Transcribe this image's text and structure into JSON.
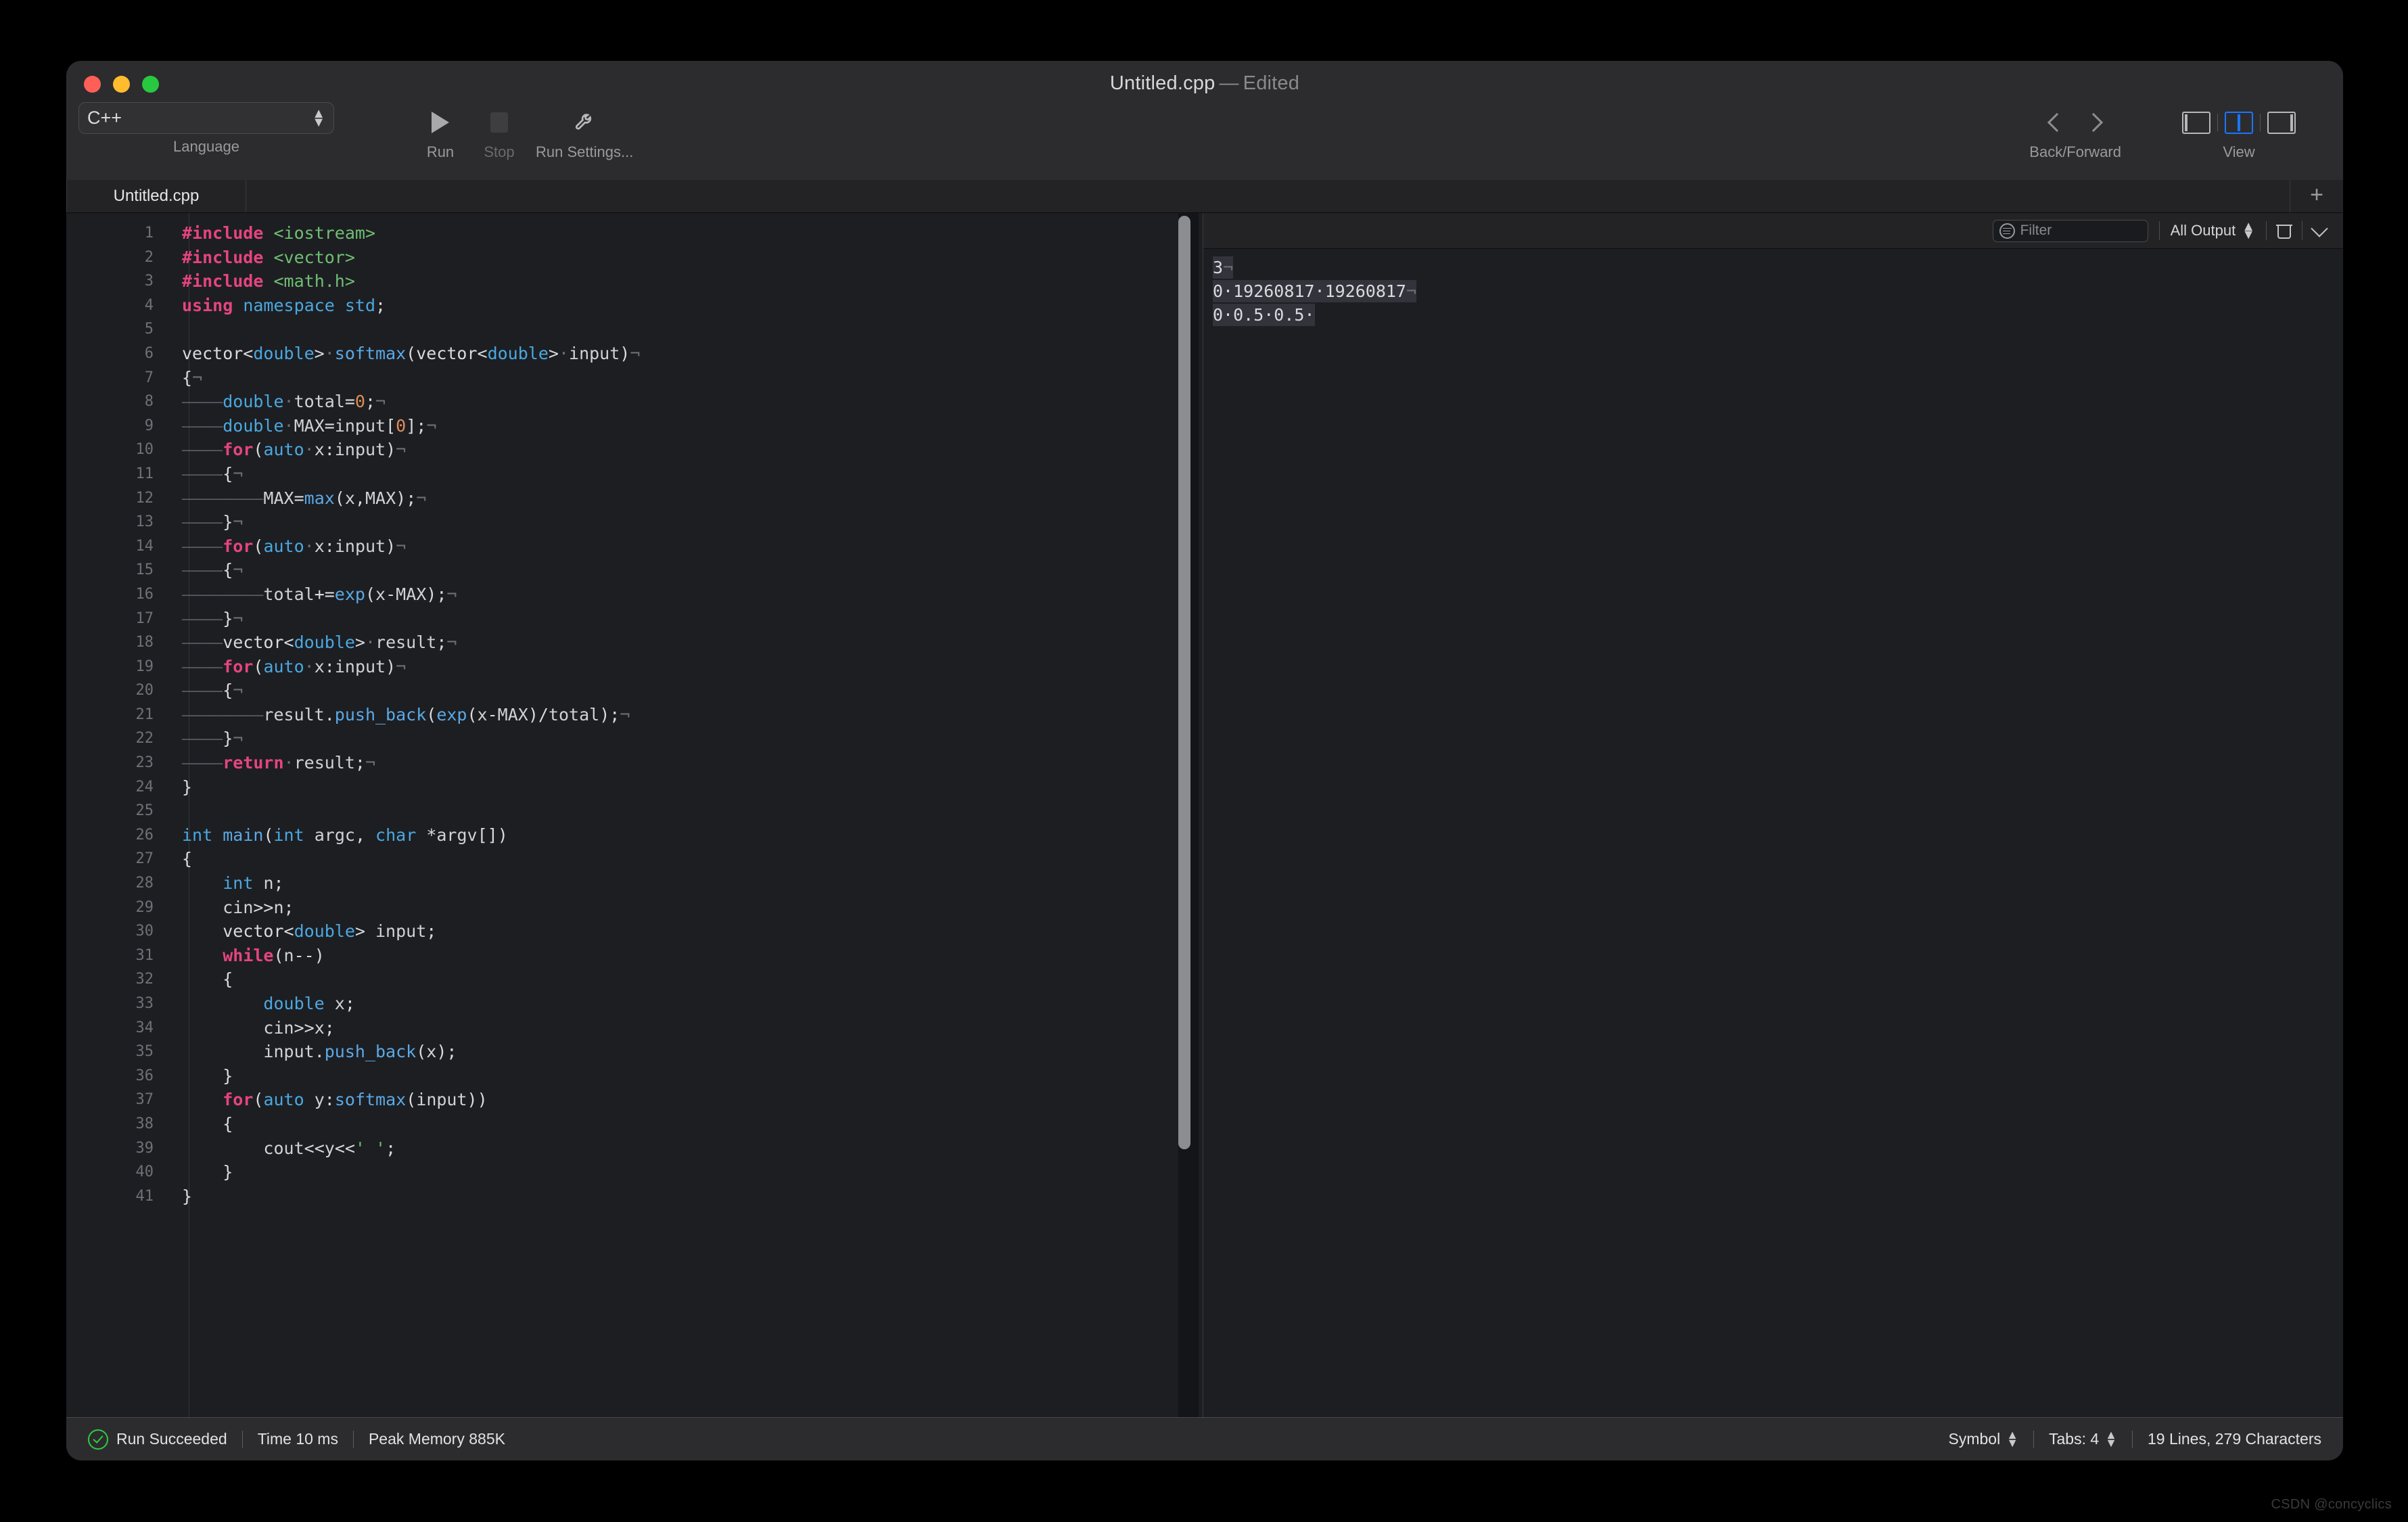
{
  "window": {
    "title_file": "Untitled.cpp",
    "title_dash": "—",
    "title_state": "Edited"
  },
  "toolbar": {
    "language": {
      "value": "C++",
      "label": "Language"
    },
    "run": {
      "label": "Run",
      "icon": "play-icon"
    },
    "stop": {
      "label": "Stop",
      "icon": "stop-icon"
    },
    "run_settings": {
      "label": "Run Settings...",
      "icon": "wrench-icon"
    },
    "back_forward": {
      "label": "Back/Forward",
      "back_icon": "chevron-left-icon",
      "forward_icon": "chevron-right-icon"
    },
    "view": {
      "label": "View",
      "options": [
        "left-panel",
        "center-panel",
        "right-panel"
      ],
      "active": "center-panel",
      "accent": "#1b75ff"
    }
  },
  "tabs": {
    "items": [
      {
        "label": "Untitled.cpp",
        "active": true
      }
    ],
    "new_tab_label": "+"
  },
  "console": {
    "filter_placeholder": "Filter",
    "filter_value": "",
    "scope": "All Output",
    "clear_icon": "trash-icon",
    "expand_icon": "chevron-down-icon",
    "output": [
      {
        "text": "3",
        "trailing": "¬",
        "highlighted": true
      },
      {
        "text": "0·19260817·19260817",
        "trailing": "¬",
        "highlighted": true
      },
      {
        "text": "0·0.5·0.5·",
        "trailing": "",
        "highlighted": true
      }
    ]
  },
  "statusbar": {
    "run_status": "Run Succeeded",
    "status_icon": "check-circle-icon",
    "time": "Time 10 ms",
    "memory": "Peak Memory 885K",
    "symbol": "Symbol",
    "tabs_setting": "Tabs: 4",
    "counts": "19 Lines, 279 Characters"
  },
  "watermark": "CSDN @concyclics",
  "editor": {
    "total_lines": 41,
    "selection_start_line": 6,
    "selection_end_line": 24,
    "code_lines": [
      {
        "n": 1,
        "sel": false,
        "tokens": [
          [
            "kw",
            "#include"
          ],
          [
            "pun",
            " "
          ],
          [
            "str",
            "<iostream>"
          ]
        ]
      },
      {
        "n": 2,
        "sel": false,
        "tokens": [
          [
            "kw",
            "#include"
          ],
          [
            "pun",
            " "
          ],
          [
            "str",
            "<vector>"
          ]
        ]
      },
      {
        "n": 3,
        "sel": false,
        "tokens": [
          [
            "kw",
            "#include"
          ],
          [
            "pun",
            " "
          ],
          [
            "str",
            "<math.h>"
          ]
        ]
      },
      {
        "n": 4,
        "sel": false,
        "tokens": [
          [
            "kw",
            "using"
          ],
          [
            "pun",
            " "
          ],
          [
            "ty",
            "namespace"
          ],
          [
            "pun",
            " "
          ],
          [
            "ty",
            "std"
          ],
          [
            "pun",
            ";"
          ]
        ]
      },
      {
        "n": 5,
        "sel": false,
        "tokens": []
      },
      {
        "n": 6,
        "sel": true,
        "tokens": [
          [
            "pun",
            "vector<"
          ],
          [
            "ty",
            "double"
          ],
          [
            "pun",
            ">"
          ],
          [
            "inv",
            "·"
          ],
          [
            "fn",
            "softmax"
          ],
          [
            "pun",
            "("
          ],
          [
            "pun",
            "vector<"
          ],
          [
            "ty",
            "double"
          ],
          [
            "pun",
            ">"
          ],
          [
            "inv",
            "·"
          ],
          [
            "id",
            "input"
          ],
          [
            "pun",
            ")"
          ],
          [
            "inv",
            "¬"
          ]
        ]
      },
      {
        "n": 7,
        "sel": true,
        "tokens": [
          [
            "pun",
            "{"
          ],
          [
            "inv",
            "¬"
          ]
        ]
      },
      {
        "n": 8,
        "sel": true,
        "tokens": [
          [
            "tab-mark",
            "————"
          ],
          [
            "ty",
            "double"
          ],
          [
            "inv",
            "·"
          ],
          [
            "id",
            "total"
          ],
          [
            "pun",
            "="
          ],
          [
            "num",
            "0"
          ],
          [
            "pun",
            ";"
          ],
          [
            "inv",
            "¬"
          ]
        ]
      },
      {
        "n": 9,
        "sel": true,
        "tokens": [
          [
            "tab-mark",
            "————"
          ],
          [
            "ty",
            "double"
          ],
          [
            "inv",
            "·"
          ],
          [
            "id",
            "MAX"
          ],
          [
            "pun",
            "="
          ],
          [
            "id",
            "input"
          ],
          [
            "pun",
            "["
          ],
          [
            "num",
            "0"
          ],
          [
            "pun",
            "];"
          ],
          [
            "inv",
            "¬"
          ]
        ]
      },
      {
        "n": 10,
        "sel": true,
        "tokens": [
          [
            "tab-mark",
            "————"
          ],
          [
            "kw",
            "for"
          ],
          [
            "pun",
            "("
          ],
          [
            "ty",
            "auto"
          ],
          [
            "inv",
            "·"
          ],
          [
            "id",
            "x"
          ],
          [
            "pun",
            ":"
          ],
          [
            "id",
            "input"
          ],
          [
            "pun",
            ")"
          ],
          [
            "inv",
            "¬"
          ]
        ]
      },
      {
        "n": 11,
        "sel": true,
        "tokens": [
          [
            "tab-mark",
            "————"
          ],
          [
            "pun",
            "{"
          ],
          [
            "inv",
            "¬"
          ]
        ]
      },
      {
        "n": 12,
        "sel": true,
        "tokens": [
          [
            "tab-mark",
            "————————"
          ],
          [
            "id",
            "MAX"
          ],
          [
            "pun",
            "="
          ],
          [
            "fn",
            "max"
          ],
          [
            "pun",
            "("
          ],
          [
            "id",
            "x"
          ],
          [
            "pun",
            ","
          ],
          [
            "id",
            "MAX"
          ],
          [
            "pun",
            ");"
          ],
          [
            "inv",
            "¬"
          ]
        ]
      },
      {
        "n": 13,
        "sel": true,
        "tokens": [
          [
            "tab-mark",
            "————"
          ],
          [
            "pun",
            "}"
          ],
          [
            "inv",
            "¬"
          ]
        ]
      },
      {
        "n": 14,
        "sel": true,
        "tokens": [
          [
            "tab-mark",
            "————"
          ],
          [
            "kw",
            "for"
          ],
          [
            "pun",
            "("
          ],
          [
            "ty",
            "auto"
          ],
          [
            "inv",
            "·"
          ],
          [
            "id",
            "x"
          ],
          [
            "pun",
            ":"
          ],
          [
            "id",
            "input"
          ],
          [
            "pun",
            ")"
          ],
          [
            "inv",
            "¬"
          ]
        ]
      },
      {
        "n": 15,
        "sel": true,
        "tokens": [
          [
            "tab-mark",
            "————"
          ],
          [
            "pun",
            "{"
          ],
          [
            "inv",
            "¬"
          ]
        ]
      },
      {
        "n": 16,
        "sel": true,
        "tokens": [
          [
            "tab-mark",
            "————————"
          ],
          [
            "id",
            "total"
          ],
          [
            "pun",
            "+="
          ],
          [
            "fn",
            "exp"
          ],
          [
            "pun",
            "("
          ],
          [
            "id",
            "x"
          ],
          [
            "pun",
            "-"
          ],
          [
            "id",
            "MAX"
          ],
          [
            "pun",
            ");"
          ],
          [
            "inv",
            "¬"
          ]
        ]
      },
      {
        "n": 17,
        "sel": true,
        "tokens": [
          [
            "tab-mark",
            "————"
          ],
          [
            "pun",
            "}"
          ],
          [
            "inv",
            "¬"
          ]
        ]
      },
      {
        "n": 18,
        "sel": true,
        "tokens": [
          [
            "tab-mark",
            "————"
          ],
          [
            "pun",
            "vector<"
          ],
          [
            "ty",
            "double"
          ],
          [
            "pun",
            ">"
          ],
          [
            "inv",
            "·"
          ],
          [
            "id",
            "result"
          ],
          [
            "pun",
            ";"
          ],
          [
            "inv",
            "¬"
          ]
        ]
      },
      {
        "n": 19,
        "sel": true,
        "tokens": [
          [
            "tab-mark",
            "————"
          ],
          [
            "kw",
            "for"
          ],
          [
            "pun",
            "("
          ],
          [
            "ty",
            "auto"
          ],
          [
            "inv",
            "·"
          ],
          [
            "id",
            "x"
          ],
          [
            "pun",
            ":"
          ],
          [
            "id",
            "input"
          ],
          [
            "pun",
            ")"
          ],
          [
            "inv",
            "¬"
          ]
        ]
      },
      {
        "n": 20,
        "sel": true,
        "tokens": [
          [
            "tab-mark",
            "————"
          ],
          [
            "pun",
            "{"
          ],
          [
            "inv",
            "¬"
          ]
        ]
      },
      {
        "n": 21,
        "sel": true,
        "tokens": [
          [
            "tab-mark",
            "————————"
          ],
          [
            "id",
            "result"
          ],
          [
            "pun",
            "."
          ],
          [
            "fn",
            "push_back"
          ],
          [
            "pun",
            "("
          ],
          [
            "fn",
            "exp"
          ],
          [
            "pun",
            "("
          ],
          [
            "id",
            "x"
          ],
          [
            "pun",
            "-"
          ],
          [
            "id",
            "MAX"
          ],
          [
            "pun",
            ")/"
          ],
          [
            "id",
            "total"
          ],
          [
            "pun",
            ");"
          ],
          [
            "inv",
            "¬"
          ]
        ]
      },
      {
        "n": 22,
        "sel": true,
        "tokens": [
          [
            "tab-mark",
            "————"
          ],
          [
            "pun",
            "}"
          ],
          [
            "inv",
            "¬"
          ]
        ]
      },
      {
        "n": 23,
        "sel": true,
        "tokens": [
          [
            "tab-mark",
            "————"
          ],
          [
            "kw",
            "return"
          ],
          [
            "inv",
            "·"
          ],
          [
            "id",
            "result"
          ],
          [
            "pun",
            ";"
          ],
          [
            "inv",
            "¬"
          ]
        ]
      },
      {
        "n": 24,
        "sel": true,
        "tokens": [
          [
            "pun",
            "}"
          ]
        ]
      },
      {
        "n": 25,
        "sel": false,
        "tokens": []
      },
      {
        "n": 26,
        "sel": false,
        "tokens": [
          [
            "ty",
            "int"
          ],
          [
            "pun",
            " "
          ],
          [
            "fn",
            "main"
          ],
          [
            "pun",
            "("
          ],
          [
            "ty",
            "int"
          ],
          [
            "pun",
            " "
          ],
          [
            "id",
            "argc"
          ],
          [
            "pun",
            ", "
          ],
          [
            "ty",
            "char"
          ],
          [
            "pun",
            " *"
          ],
          [
            "id",
            "argv"
          ],
          [
            "pun",
            "[])"
          ]
        ]
      },
      {
        "n": 27,
        "sel": false,
        "tokens": [
          [
            "pun",
            "{"
          ]
        ]
      },
      {
        "n": 28,
        "sel": false,
        "tokens": [
          [
            "pun",
            "    "
          ],
          [
            "ty",
            "int"
          ],
          [
            "pun",
            " "
          ],
          [
            "id",
            "n"
          ],
          [
            "pun",
            ";"
          ]
        ]
      },
      {
        "n": 29,
        "sel": false,
        "tokens": [
          [
            "pun",
            "    "
          ],
          [
            "id",
            "cin"
          ],
          [
            "pun",
            ">>"
          ],
          [
            "id",
            "n"
          ],
          [
            "pun",
            ";"
          ]
        ]
      },
      {
        "n": 30,
        "sel": false,
        "tokens": [
          [
            "pun",
            "    "
          ],
          [
            "pun",
            "vector<"
          ],
          [
            "ty",
            "double"
          ],
          [
            "pun",
            "> "
          ],
          [
            "id",
            "input"
          ],
          [
            "pun",
            ";"
          ]
        ]
      },
      {
        "n": 31,
        "sel": false,
        "tokens": [
          [
            "pun",
            "    "
          ],
          [
            "kw",
            "while"
          ],
          [
            "pun",
            "("
          ],
          [
            "id",
            "n"
          ],
          [
            "pun",
            "--)"
          ]
        ]
      },
      {
        "n": 32,
        "sel": false,
        "tokens": [
          [
            "pun",
            "    {"
          ]
        ]
      },
      {
        "n": 33,
        "sel": false,
        "tokens": [
          [
            "pun",
            "        "
          ],
          [
            "ty",
            "double"
          ],
          [
            "pun",
            " "
          ],
          [
            "id",
            "x"
          ],
          [
            "pun",
            ";"
          ]
        ]
      },
      {
        "n": 34,
        "sel": false,
        "tokens": [
          [
            "pun",
            "        "
          ],
          [
            "id",
            "cin"
          ],
          [
            "pun",
            ">>"
          ],
          [
            "id",
            "x"
          ],
          [
            "pun",
            ";"
          ]
        ]
      },
      {
        "n": 35,
        "sel": false,
        "tokens": [
          [
            "pun",
            "        "
          ],
          [
            "id",
            "input"
          ],
          [
            "pun",
            "."
          ],
          [
            "fn",
            "push_back"
          ],
          [
            "pun",
            "("
          ],
          [
            "id",
            "x"
          ],
          [
            "pun",
            ");"
          ]
        ]
      },
      {
        "n": 36,
        "sel": false,
        "tokens": [
          [
            "pun",
            "    }"
          ]
        ]
      },
      {
        "n": 37,
        "sel": false,
        "tokens": [
          [
            "pun",
            "    "
          ],
          [
            "kw",
            "for"
          ],
          [
            "pun",
            "("
          ],
          [
            "ty",
            "auto"
          ],
          [
            "pun",
            " "
          ],
          [
            "id",
            "y"
          ],
          [
            "pun",
            ":"
          ],
          [
            "fn",
            "softmax"
          ],
          [
            "pun",
            "("
          ],
          [
            "id",
            "input"
          ],
          [
            "pun",
            "))"
          ]
        ]
      },
      {
        "n": 38,
        "sel": false,
        "tokens": [
          [
            "pun",
            "    {"
          ]
        ]
      },
      {
        "n": 39,
        "sel": false,
        "tokens": [
          [
            "pun",
            "        "
          ],
          [
            "id",
            "cout"
          ],
          [
            "pun",
            "<<"
          ],
          [
            "id",
            "y"
          ],
          [
            "pun",
            "<<"
          ],
          [
            "str",
            "' '"
          ],
          [
            "pun",
            ";"
          ]
        ]
      },
      {
        "n": 40,
        "sel": false,
        "tokens": [
          [
            "pun",
            "    }"
          ]
        ]
      },
      {
        "n": 41,
        "sel": false,
        "tokens": [
          [
            "pun",
            "}"
          ]
        ]
      }
    ]
  }
}
